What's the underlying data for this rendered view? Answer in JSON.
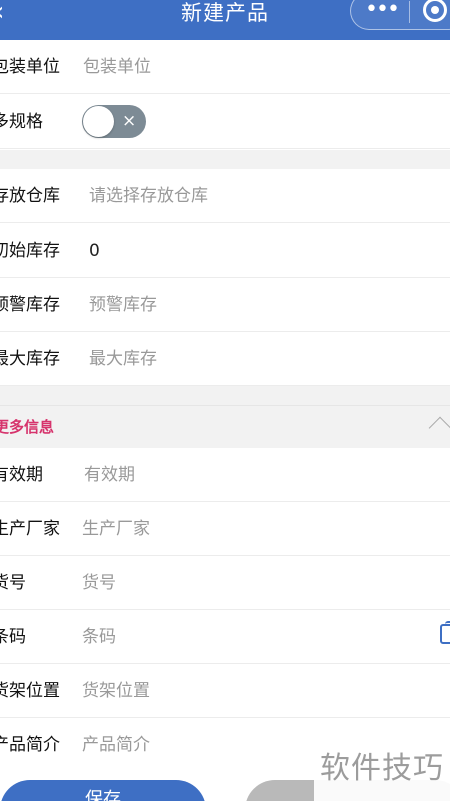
{
  "header": {
    "back_icon": "‹",
    "title": "新建产品",
    "menu_icon": "•••"
  },
  "colors": {
    "primary": "#3e6fc4",
    "accent": "#d6336c",
    "toggle_off": "#7d8b95"
  },
  "fields_top": [
    {
      "label": "包装单位",
      "placeholder": "包装单位"
    },
    {
      "label": "多规格",
      "toggle_state": "off",
      "toggle_icon": "×"
    }
  ],
  "fields_stock": [
    {
      "label": "存放仓库",
      "placeholder": "请选择存放仓库"
    },
    {
      "label": "初始库存",
      "value": "0"
    },
    {
      "label": "预警库存",
      "placeholder": "预警库存"
    },
    {
      "label": "最大库存",
      "placeholder": "最大库存"
    }
  ],
  "more_section": {
    "title": "更多信息",
    "expanded": true
  },
  "fields_more": [
    {
      "label": "有效期",
      "placeholder": "有效期"
    },
    {
      "label": "生产厂家",
      "placeholder": "生产厂家"
    },
    {
      "label": "货号",
      "placeholder": "货号"
    },
    {
      "label": "条码",
      "placeholder": "条码",
      "icon": "copy-icon"
    },
    {
      "label": "货架位置",
      "placeholder": "货架位置"
    },
    {
      "label": "产品简介",
      "placeholder": "产品简介"
    }
  ],
  "buttons": {
    "save": "保存"
  },
  "watermark": "软件技巧"
}
